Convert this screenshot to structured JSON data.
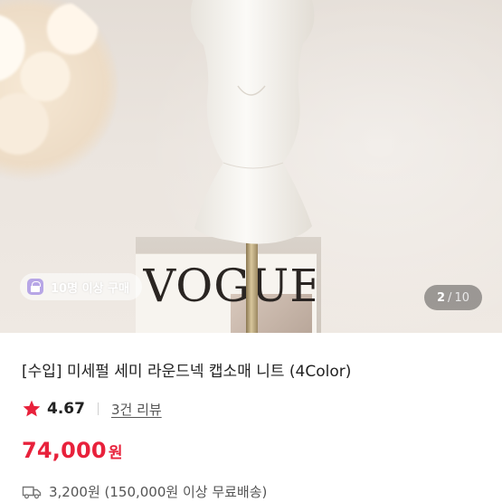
{
  "gallery": {
    "badge_text": "10명 이상 구매",
    "current": "2",
    "separator": "/",
    "total": "10",
    "photo_text": "VOGUE"
  },
  "product": {
    "title": "[수입] 미세펄 세미 라운드넥 캡소매 니트 (4Color)",
    "rating": "4.67",
    "review_link": "3건 리뷰",
    "price": "74,000",
    "price_unit": "원",
    "shipping": "3,200원 (150,000원 이상 무료배송)"
  },
  "colors": {
    "accent": "#e8213b",
    "badge_icon": "#b7a6e6"
  },
  "icons": {
    "star": "star-icon",
    "shipping": "truck-icon",
    "badge": "shopping-bag-icon"
  }
}
